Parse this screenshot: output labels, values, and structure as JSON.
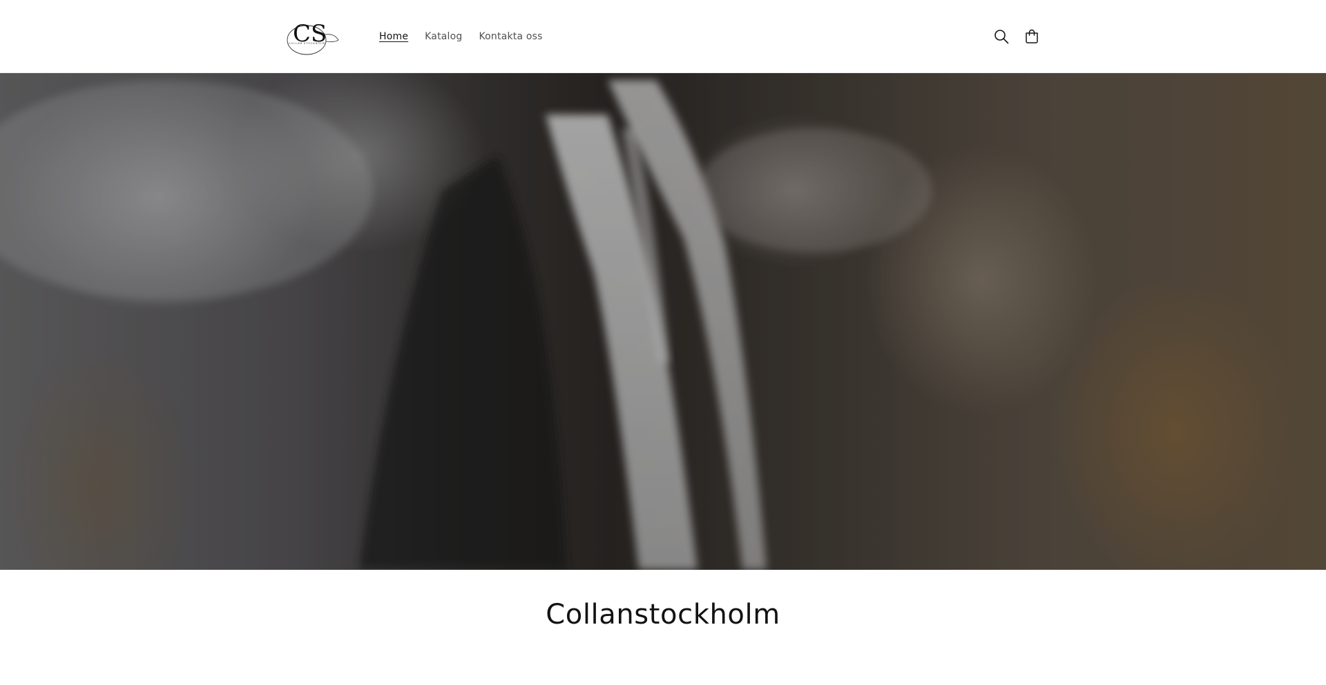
{
  "header": {
    "logo": {
      "text": "CS",
      "tagline": "COLLAN STOCKHOLM"
    },
    "nav": [
      {
        "label": "Home",
        "active": true
      },
      {
        "label": "Katalog",
        "active": false
      },
      {
        "label": "Kontakta oss",
        "active": false
      }
    ],
    "icons": [
      "search-icon",
      "cart-icon"
    ]
  },
  "hero": {
    "image": "waterfall-cliff"
  },
  "collection": {
    "title": "Collanstockholm"
  },
  "colors": {
    "text": "#121212",
    "nav_text": "#505050",
    "background": "#ffffff"
  }
}
